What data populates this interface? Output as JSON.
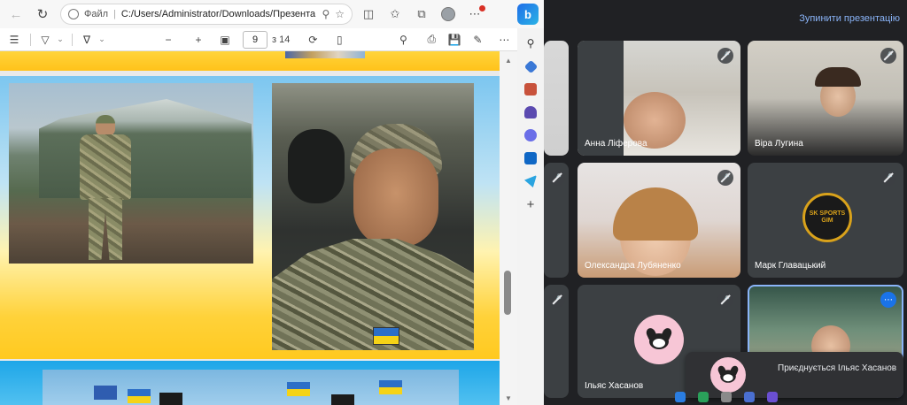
{
  "browser": {
    "address": {
      "file_label": "Файл",
      "separator": "|",
      "url": "C:/Users/Administrator/Downloads/Презента..."
    },
    "pdf_toolbar": {
      "current_page": "9",
      "page_total": "з 14"
    }
  },
  "meeting": {
    "stop_presenting_label": "Зупинити презентацію",
    "participants": [
      {
        "name": "Анна Ліферова"
      },
      {
        "name": "Віра Лугина"
      },
      {
        "name": "Олександра Лубяненко"
      },
      {
        "name": "Марк Главацький"
      },
      {
        "name": "Ільяс Хасанов"
      }
    ],
    "logo_text": "SK SPORTS GIM",
    "toast": {
      "text": "Приєднується Ільяс Хасанов"
    }
  },
  "colors": {
    "meet_bg": "#202124",
    "tile_bg": "#3c4043",
    "accent": "#8ab4f8",
    "slide_yellow": "#ffc91f",
    "slide_blue": "#1ea6e8"
  }
}
